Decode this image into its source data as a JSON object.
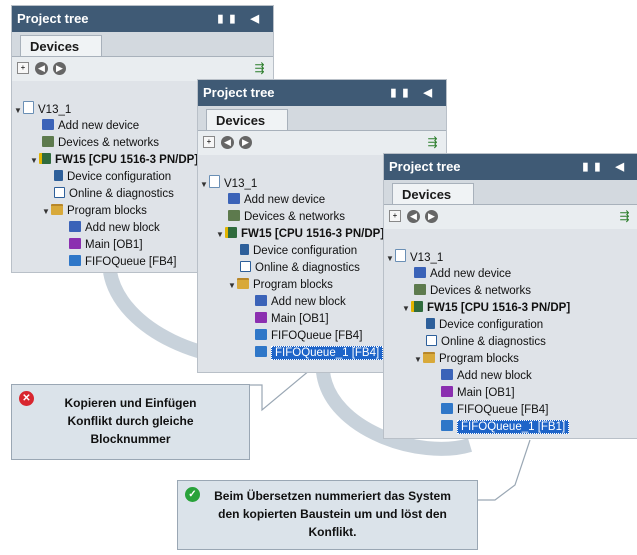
{
  "panel_title": "Project tree",
  "devices_tab": "Devices",
  "tree": {
    "root": "V13_1",
    "add_device": "Add new device",
    "devices_networks": "Devices & networks",
    "plc_short": "FW15 [CPU 1516-3 PN/DP]",
    "plc": "FW15 [CPU 1516-3 PN/DP]",
    "device_config": "Device configuration",
    "online_diag": "Online & diagnostics",
    "program_blocks": "Program blocks",
    "add_block": "Add new block",
    "main": "Main [OB1]",
    "fifo": "FIFOQueue [FB4]",
    "fifo_copy_conflict": "FIFOQueue_1 [FB4]",
    "fifo_copy_resolved": "FIFOQueue_1 [FB1]"
  },
  "callouts": {
    "error": "Kopieren und Einfügen Konflikt durch gleiche Blocknummer",
    "success": "Beim Übersetzen nummeriert das System den kopierten Baustein um und löst den Konflikt."
  },
  "colors": {
    "titlebar": "#3f5a75",
    "selection": "#1e64c8",
    "error": "#d8262f",
    "success": "#28a23a"
  }
}
